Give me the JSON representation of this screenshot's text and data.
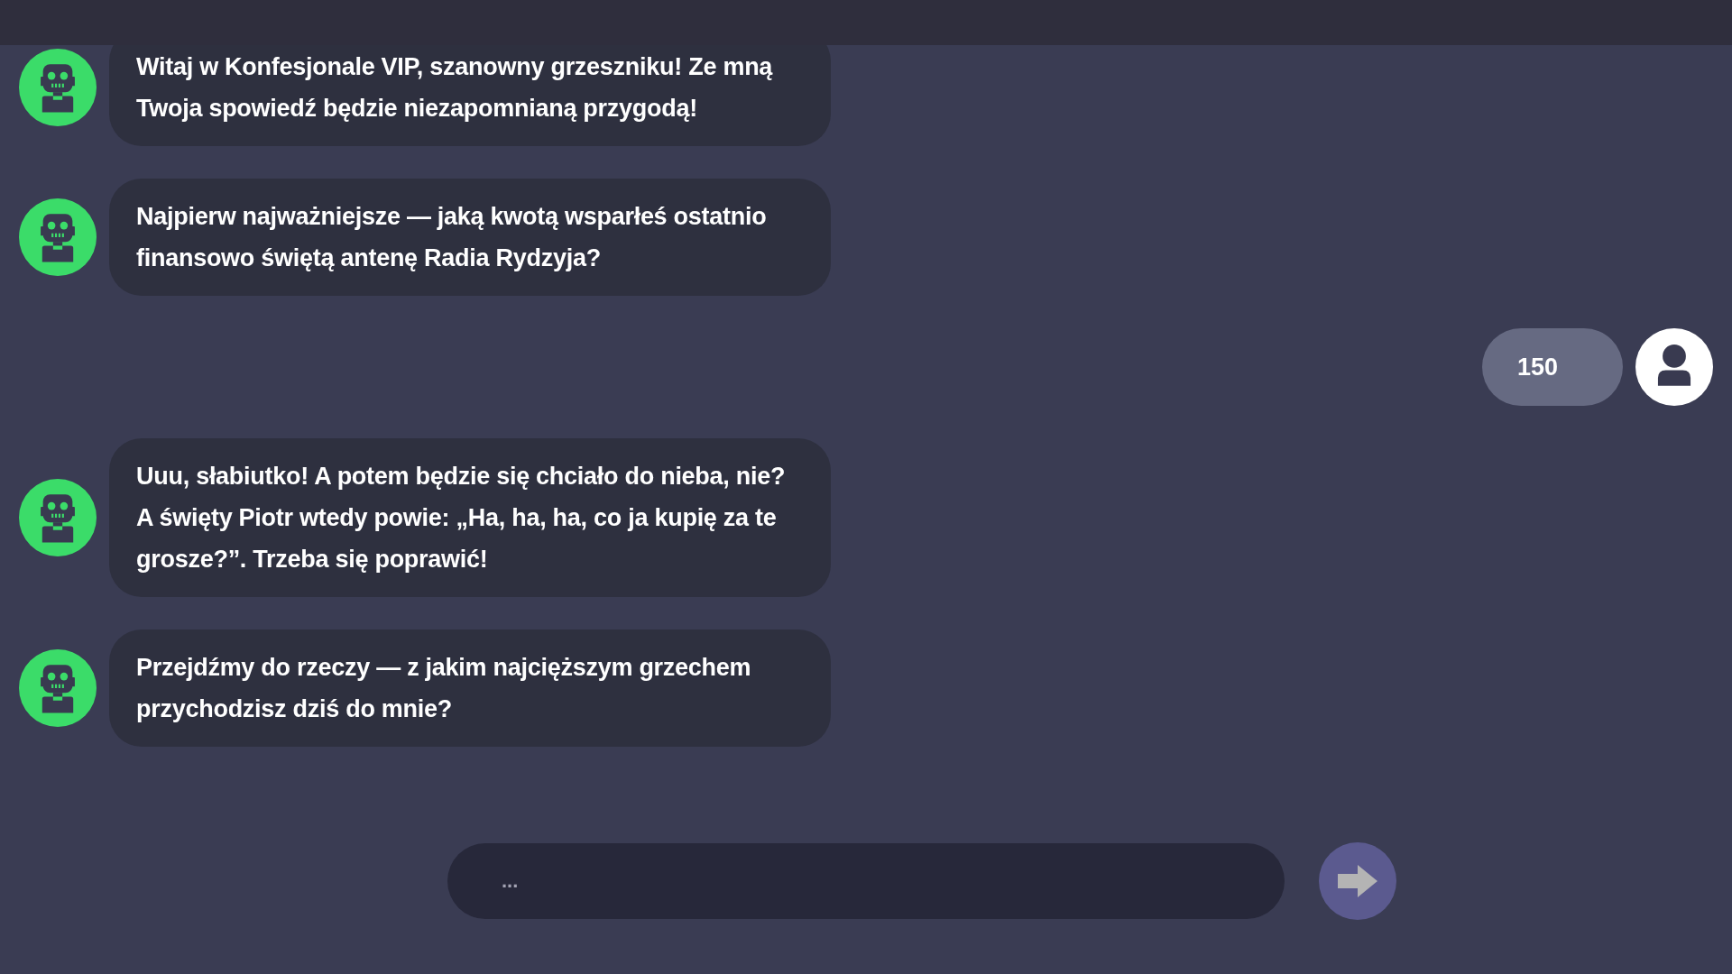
{
  "messages": [
    {
      "kind": "bot",
      "text": "Witaj w Konfesjonale VIP, szanowny grzeszniku! Ze mną Twoja spowiedź będzie niezapomnianą przygodą!"
    },
    {
      "kind": "bot",
      "text": "Najpierw najważniejsze — jaką kwotą wsparłeś ostatnio finansowo świętą antenę Radia Rydzyja?"
    },
    {
      "kind": "user",
      "text": "150"
    },
    {
      "kind": "bot",
      "text": "Uuu, słabiutko! A potem będzie się chciało do nieba, nie? A święty Piotr wtedy powie: „Ha, ha, ha, co ja kupię za te grosze?”. Trzeba się poprawić!"
    },
    {
      "kind": "bot",
      "text": "Przejdźmy do rzeczy — z jakim najcięższym grzechem przychodzisz dziś do mnie?"
    }
  ],
  "composer": {
    "placeholder": "..."
  }
}
